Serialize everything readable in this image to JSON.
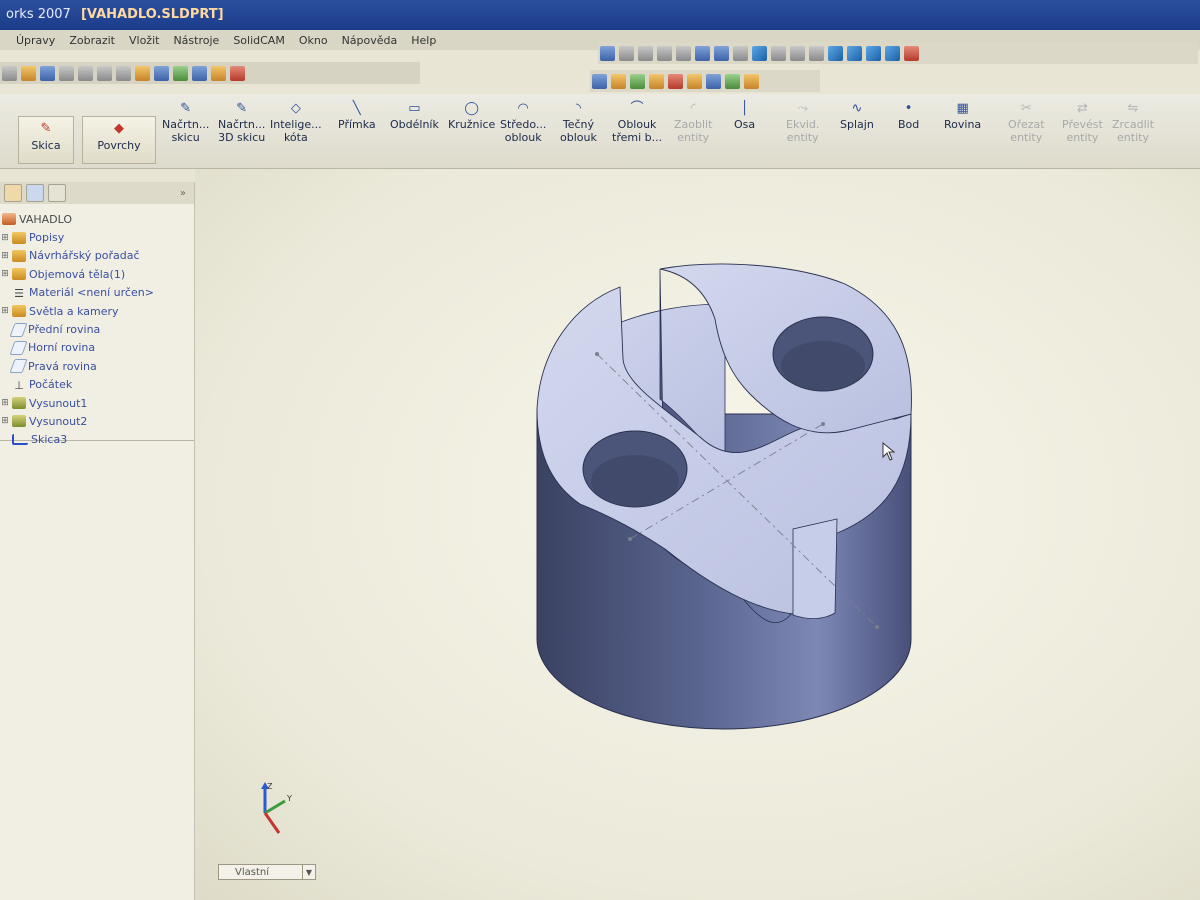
{
  "window": {
    "title_prefix": "orks 2007",
    "title_doc": "[VAHADLO.SLDPRT]"
  },
  "menu": [
    "Úpravy",
    "Zobrazit",
    "Vložit",
    "Nástroje",
    "SolidCAM",
    "Okno",
    "Nápověda",
    "Help"
  ],
  "command_manager": {
    "sketch_button": "Skica",
    "surfaces_button": "Povrchy",
    "commands": [
      {
        "name": "cmd-sketch-draw",
        "line1": "Načrtn...",
        "line2": "skicu",
        "enabled": true,
        "icon": "sketch-draw-icon"
      },
      {
        "name": "cmd-3d-sketch",
        "line1": "Načrtn...",
        "line2": "3D skicu",
        "enabled": true,
        "icon": "3d-sketch-icon"
      },
      {
        "name": "cmd-smart-dimension",
        "line1": "Intelige...",
        "line2": "kóta",
        "enabled": true,
        "icon": "smart-dimension-icon"
      },
      {
        "name": "cmd-line",
        "line1": "Přímka",
        "line2": "",
        "enabled": true,
        "icon": "line-icon"
      },
      {
        "name": "cmd-rectangle",
        "line1": "Obdélník",
        "line2": "",
        "enabled": true,
        "icon": "rectangle-icon"
      },
      {
        "name": "cmd-circle",
        "line1": "Kružnice",
        "line2": "",
        "enabled": true,
        "icon": "circle-icon"
      },
      {
        "name": "cmd-center-arc",
        "line1": "Středo...",
        "line2": "oblouk",
        "enabled": true,
        "icon": "center-arc-icon"
      },
      {
        "name": "cmd-tangent-arc",
        "line1": "Tečný",
        "line2": "oblouk",
        "enabled": true,
        "icon": "tangent-arc-icon"
      },
      {
        "name": "cmd-3point-arc",
        "line1": "Oblouk",
        "line2": "třemi b...",
        "enabled": true,
        "icon": "three-point-arc-icon"
      },
      {
        "name": "cmd-fillet",
        "line1": "Zaoblit",
        "line2": "entity",
        "enabled": false,
        "icon": "fillet-icon"
      },
      {
        "name": "cmd-centerline",
        "line1": "Osa",
        "line2": "",
        "enabled": true,
        "icon": "centerline-icon"
      },
      {
        "name": "cmd-offset",
        "line1": "Ekvid.",
        "line2": "entity",
        "enabled": false,
        "icon": "offset-icon"
      },
      {
        "name": "cmd-spline",
        "line1": "Splajn",
        "line2": "",
        "enabled": true,
        "icon": "spline-icon"
      },
      {
        "name": "cmd-point",
        "line1": "Bod",
        "line2": "",
        "enabled": true,
        "icon": "point-icon"
      },
      {
        "name": "cmd-plane",
        "line1": "Rovina",
        "line2": "",
        "enabled": true,
        "icon": "plane-icon"
      },
      {
        "name": "cmd-trim",
        "line1": "Ořezat",
        "line2": "entity",
        "enabled": false,
        "icon": "trim-icon"
      },
      {
        "name": "cmd-convert",
        "line1": "Převést",
        "line2": "entity",
        "enabled": false,
        "icon": "convert-icon"
      },
      {
        "name": "cmd-mirror",
        "line1": "Zrcadlit",
        "line2": "entity",
        "enabled": false,
        "icon": "mirror-icon"
      }
    ]
  },
  "feature_tree": {
    "root": "VAHADLO",
    "items": [
      {
        "label": "Popisy",
        "icon": "annotations-icon",
        "expandable": true
      },
      {
        "label": "Návrhářský pořadač",
        "icon": "design-binder-icon",
        "expandable": true
      },
      {
        "label": "Objemová těla(1)",
        "icon": "solid-bodies-icon",
        "expandable": true
      },
      {
        "label": "Materiál <není určen>",
        "icon": "material-icon",
        "expandable": false
      },
      {
        "label": "Světla a kamery",
        "icon": "lights-cameras-icon",
        "expandable": true
      },
      {
        "label": "Přední rovina",
        "icon": "plane-icon",
        "expandable": false
      },
      {
        "label": "Horní rovina",
        "icon": "plane-icon",
        "expandable": false
      },
      {
        "label": "Pravá rovina",
        "icon": "plane-icon",
        "expandable": false
      },
      {
        "label": "Počátek",
        "icon": "origin-icon",
        "expandable": false
      },
      {
        "label": "Vysunout1",
        "icon": "extrude-icon",
        "expandable": true
      },
      {
        "label": "Vysunout2",
        "icon": "extrude-icon",
        "expandable": true
      },
      {
        "label": "Skica3",
        "icon": "sketch-icon",
        "expandable": false
      }
    ]
  },
  "viewport": {
    "view_orientation": "Vlastní",
    "model_colors": {
      "side_dark": "#3c4565",
      "side_light": "#8a95c2",
      "top": "#c3cae8",
      "hole": "#4b5579"
    }
  }
}
